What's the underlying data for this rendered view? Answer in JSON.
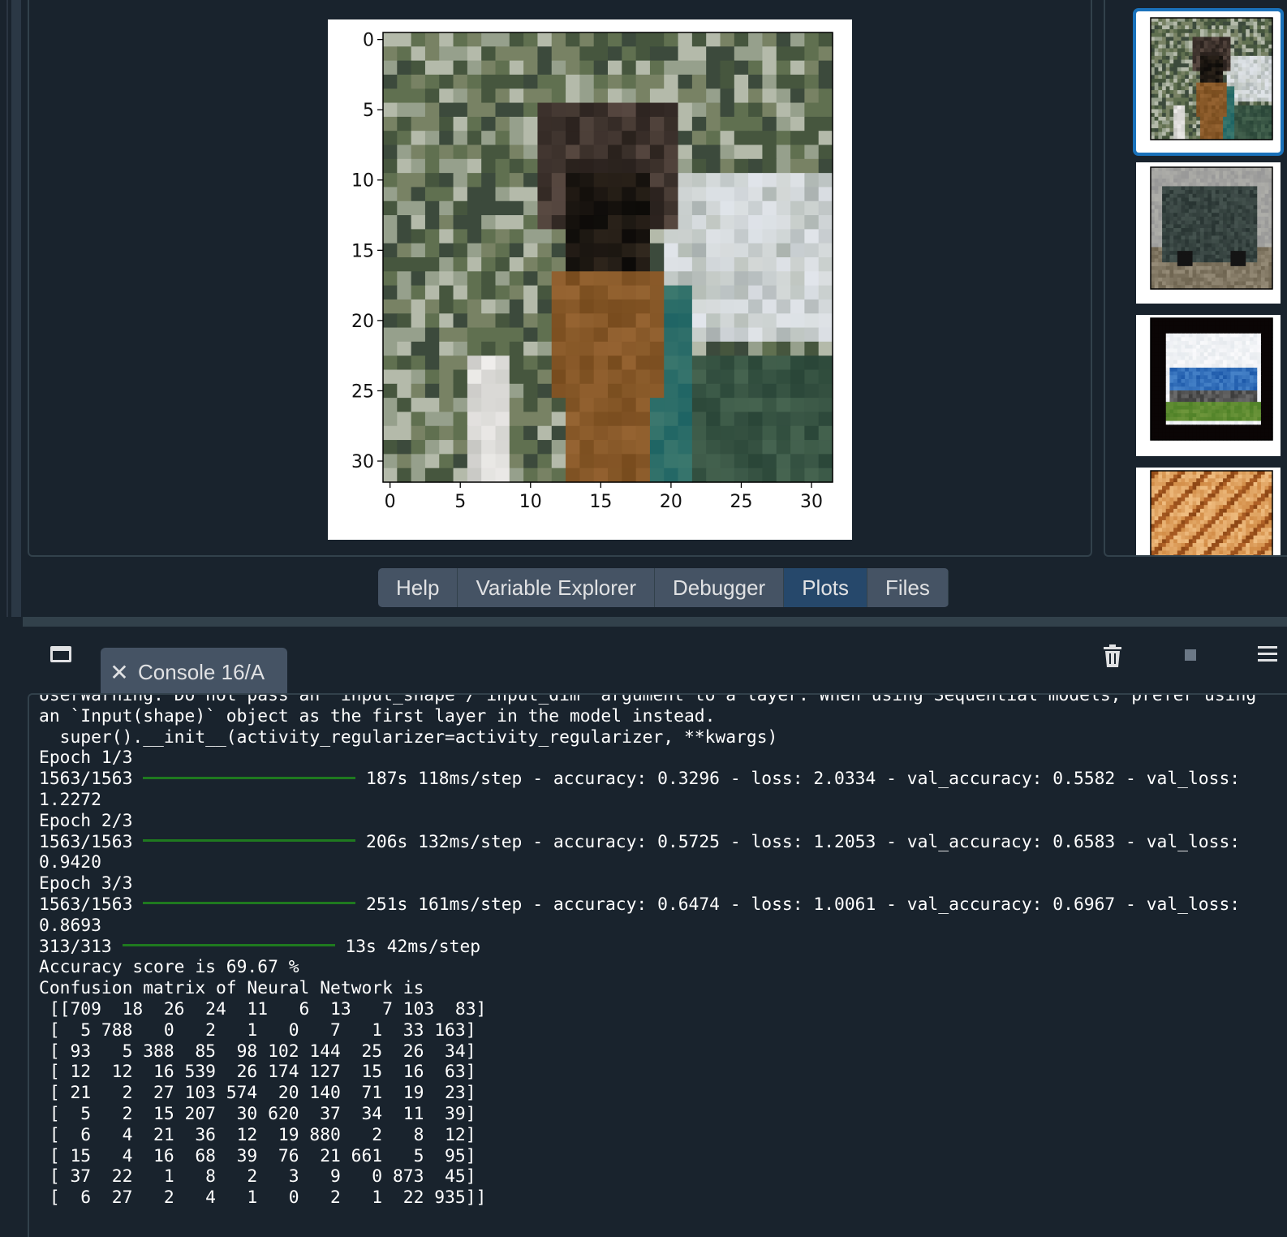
{
  "plots": {
    "main_figure": {
      "x_ticks": [
        "0",
        "5",
        "10",
        "15",
        "20",
        "25",
        "30"
      ],
      "y_ticks": [
        "0",
        "5",
        "10",
        "15",
        "20",
        "25",
        "30"
      ]
    },
    "thumbnails": [
      {
        "name": "deer-image",
        "selected": true
      },
      {
        "name": "truck-image",
        "selected": false
      },
      {
        "name": "airplane-image",
        "selected": false
      },
      {
        "name": "dog-image",
        "selected": false
      }
    ]
  },
  "tabs": [
    {
      "label": "Help",
      "active": false
    },
    {
      "label": "Variable Explorer",
      "active": false
    },
    {
      "label": "Debugger",
      "active": false
    },
    {
      "label": "Plots",
      "active": true
    },
    {
      "label": "Files",
      "active": false
    }
  ],
  "console": {
    "tab_label": "Console 16/A",
    "close_glyph": "✕",
    "lines": {
      "warn_cut": "UserWarning: Do not pass an `input_shape`/`input_dim` argument to a layer. When using Sequential models, prefer using",
      "warn2": "an `Input(shape)` object as the first layer in the model instead.",
      "warn3": "  super().__init__(activity_regularizer=activity_regularizer, **kwargs)",
      "e1": "Epoch 1/3",
      "e1_steps": "1563/1563",
      "e1_stats": " 187s 118ms/step - accuracy: 0.3296 - loss: 2.0334 - val_accuracy: 0.5582 - val_loss:",
      "e1_val": "1.2272",
      "e2": "Epoch 2/3",
      "e2_steps": "1563/1563",
      "e2_stats": " 206s 132ms/step - accuracy: 0.5725 - loss: 1.2053 - val_accuracy: 0.6583 - val_loss:",
      "e2_val": "0.9420",
      "e3": "Epoch 3/3",
      "e3_steps": "1563/1563",
      "e3_stats": " 251s 161ms/step - accuracy: 0.6474 - loss: 1.0061 - val_accuracy: 0.6967 - val_loss:",
      "e3_val": "0.8693",
      "eval_steps": "313/313",
      "eval_stats": " 13s 42ms/step",
      "acc": "Accuracy score is 69.67 %",
      "cm_title": "Confusion matrix of Neural Network is",
      "cm": [
        " [[709  18  26  24  11   6  13   7 103  83]",
        " [  5 788   0   2   1   0   7   1  33 163]",
        " [ 93   5 388  85  98 102 144  25  26  34]",
        " [ 12  12  16 539  26 174 127  15  16  63]",
        " [ 21   2  27 103 574  20 140  71  19  23]",
        " [  5   2  15 207  30 620  37  34  11  39]",
        " [  6   4  21  36  12  19 880   2   8  12]",
        " [ 15   4  16  68  39  76  21 661   5  95]",
        " [ 37  22   1   8   2   3   9   0 873  45]",
        " [  6  27   2   4   1   0   2   1  22 935]]"
      ]
    }
  }
}
